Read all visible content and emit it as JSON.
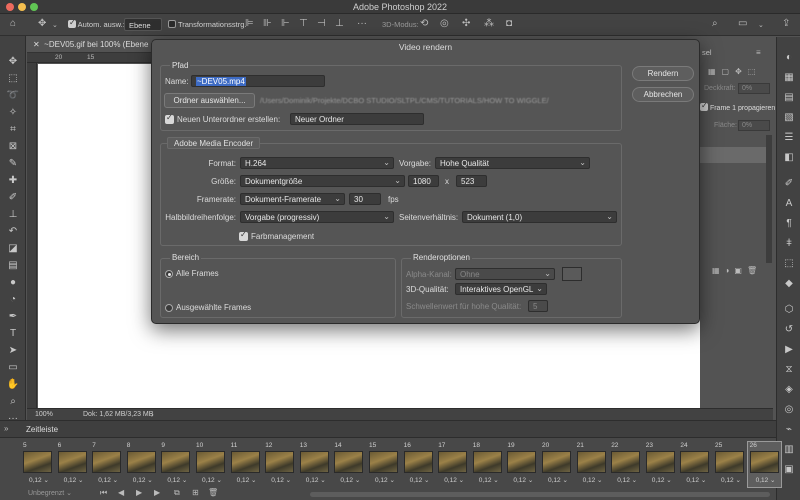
{
  "app": {
    "title": "Adobe Photoshop 2022"
  },
  "options_bar": {
    "auto_select_label": "Autom. ausw.:",
    "auto_select_value": "Ebene",
    "transform_label": "Transformationsstrg.",
    "mode3d_label": "3D-Modus:"
  },
  "document": {
    "tab_title": "~DEV05.gif bei 100% (Ebene 1,",
    "ruler_marks": [
      "20",
      "15"
    ],
    "zoom": "100%",
    "doc_info": "Dok: 1,62 MB/3,23 MB"
  },
  "right_panel": {
    "tab_fragment": "sel",
    "deckkraft_label": "Deckkraft:",
    "deckkraft_value": "0%",
    "frame_propagate": "Frame 1 propagieren",
    "flaeche_label": "Fläche:",
    "flaeche_value": "0%"
  },
  "timeline": {
    "title": "Zeitleiste",
    "loop_value": "Unbegrenzt",
    "frames": [
      {
        "num": "5",
        "dur": "0,12"
      },
      {
        "num": "6",
        "dur": "0,12"
      },
      {
        "num": "7",
        "dur": "0,12"
      },
      {
        "num": "8",
        "dur": "0,12"
      },
      {
        "num": "9",
        "dur": "0,12"
      },
      {
        "num": "10",
        "dur": "0,12"
      },
      {
        "num": "11",
        "dur": "0,12"
      },
      {
        "num": "12",
        "dur": "0,12"
      },
      {
        "num": "13",
        "dur": "0,12"
      },
      {
        "num": "14",
        "dur": "0,12"
      },
      {
        "num": "15",
        "dur": "0,12"
      },
      {
        "num": "16",
        "dur": "0,12"
      },
      {
        "num": "17",
        "dur": "0,12"
      },
      {
        "num": "18",
        "dur": "0,12"
      },
      {
        "num": "19",
        "dur": "0,12"
      },
      {
        "num": "20",
        "dur": "0,12"
      },
      {
        "num": "21",
        "dur": "0,12"
      },
      {
        "num": "22",
        "dur": "0,12"
      },
      {
        "num": "23",
        "dur": "0,12"
      },
      {
        "num": "24",
        "dur": "0,12"
      },
      {
        "num": "25",
        "dur": "0,12"
      },
      {
        "num": "26",
        "dur": "0,12"
      }
    ]
  },
  "dialog": {
    "title": "Video rendern",
    "pfad": {
      "label": "Pfad",
      "name_label": "Name:",
      "name_value": "~DEV05.mp4",
      "choose_folder": "Ordner auswählen...",
      "folder_path": "/Users/Dominik/Projekte/DCBO STUDIO/SLTPL/CMS/TUTORIALS/HOW TO WIGGLE/",
      "new_subfolder_label": "Neuen Unterordner erstellen:",
      "new_subfolder_value": "Neuer Ordner"
    },
    "buttons": {
      "render": "Rendern",
      "cancel": "Abbrechen"
    },
    "encoder": {
      "tab": "Adobe Media Encoder",
      "format_label": "Format:",
      "format_value": "H.264",
      "preset_label": "Vorgabe:",
      "preset_value": "Hohe Qualität",
      "size_label": "Größe:",
      "size_value": "Dokumentgröße",
      "width": "1080",
      "x": "x",
      "height": "523",
      "framerate_label": "Framerate:",
      "framerate_value": "Dokument-Framerate",
      "fps_value": "30",
      "fps_unit": "fps",
      "field_order_label": "Halbbildreihenfolge:",
      "field_order_value": "Vorgabe (progressiv)",
      "aspect_label": "Seitenverhältnis:",
      "aspect_value": "Dokument (1,0)",
      "color_mgmt": "Farbmanagement"
    },
    "range": {
      "label": "Bereich",
      "all_frames": "Alle Frames",
      "selected_frames": "Ausgewählte Frames"
    },
    "render_options": {
      "label": "Renderoptionen",
      "alpha_label": "Alpha-Kanal:",
      "alpha_value": "Ohne",
      "quality_label": "3D-Qualität:",
      "quality_value": "Interaktives OpenGL",
      "threshold_label": "Schwellenwert für hohe Qualität:",
      "threshold_value": "5"
    }
  }
}
